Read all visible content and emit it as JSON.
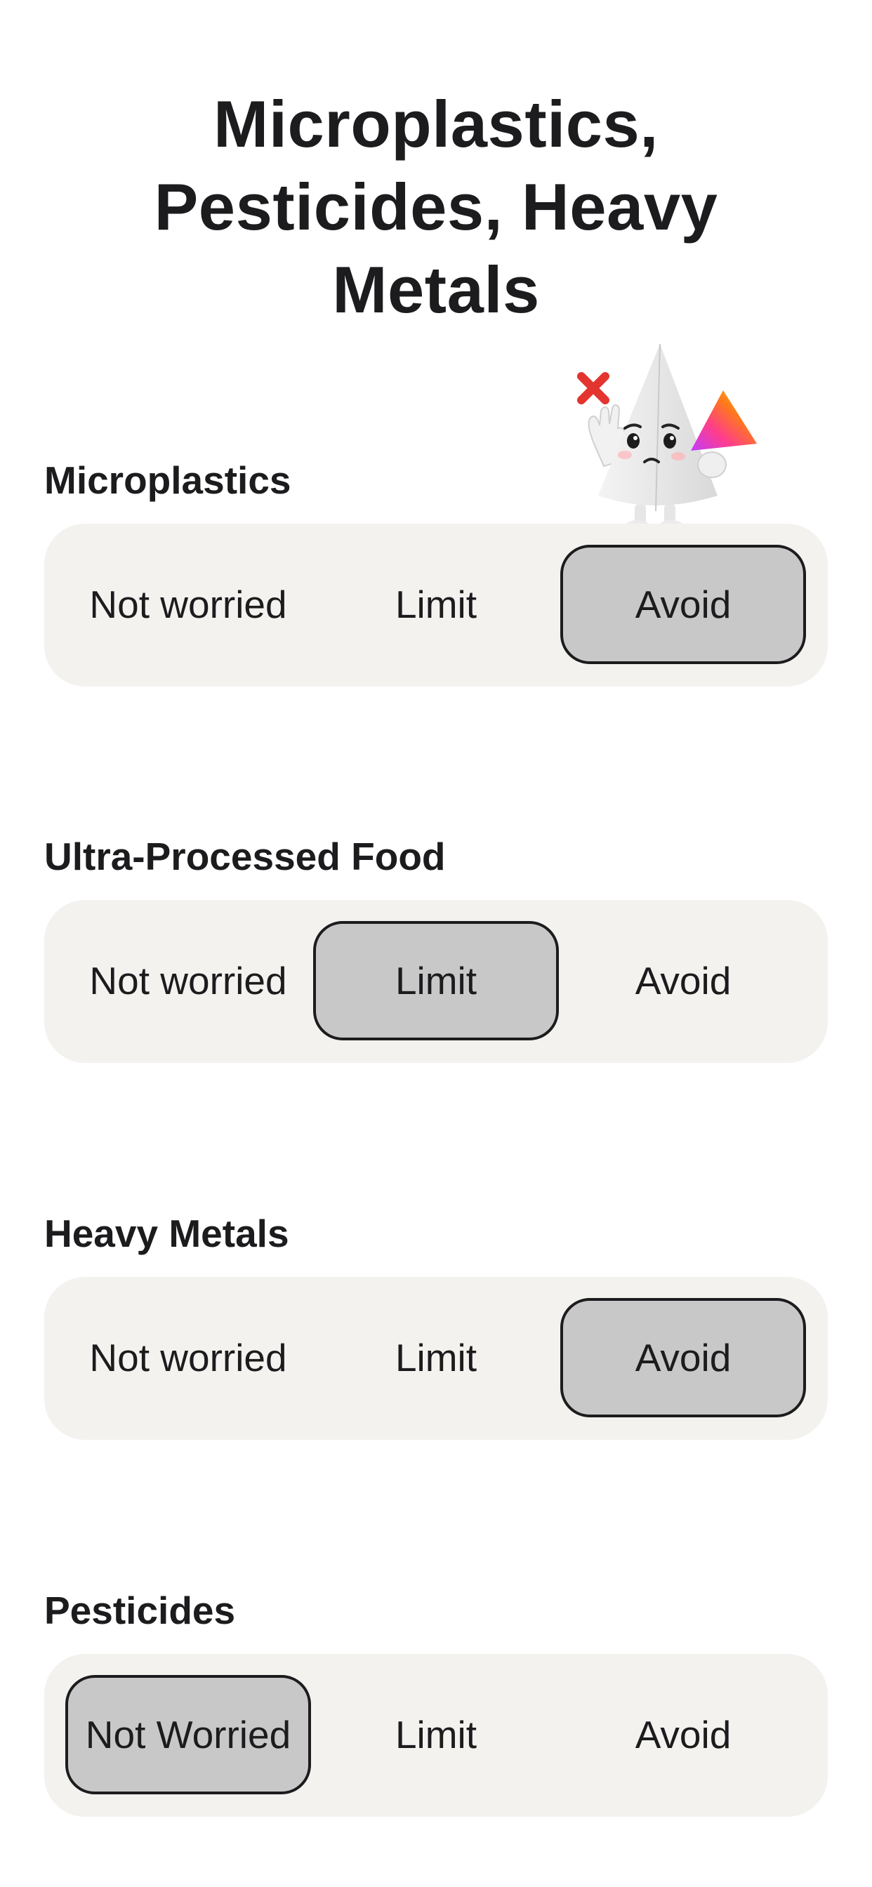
{
  "title": "Microplastics, Pesticides, Heavy Metals",
  "colors": {
    "background": "#ffffff",
    "segment_track": "#f3f2ef",
    "segment_selected_fill": "#c8c8c8",
    "segment_selected_border": "#1c1c1e",
    "text": "#1c1c1e"
  },
  "mascot": {
    "icon": "worried-triangle-mascot-icon",
    "accent_icon": "red-x-icon"
  },
  "sections": [
    {
      "label": "Microplastics",
      "options": [
        "Not worried",
        "Limit",
        "Avoid"
      ],
      "selected_index": 2
    },
    {
      "label": "Ultra-Processed Food",
      "options": [
        "Not worried",
        "Limit",
        "Avoid"
      ],
      "selected_index": 1
    },
    {
      "label": "Heavy Metals",
      "options": [
        "Not worried",
        "Limit",
        "Avoid"
      ],
      "selected_index": 2
    },
    {
      "label": "Pesticides",
      "options": [
        "Not Worried",
        "Limit",
        "Avoid"
      ],
      "selected_index": 0
    }
  ]
}
